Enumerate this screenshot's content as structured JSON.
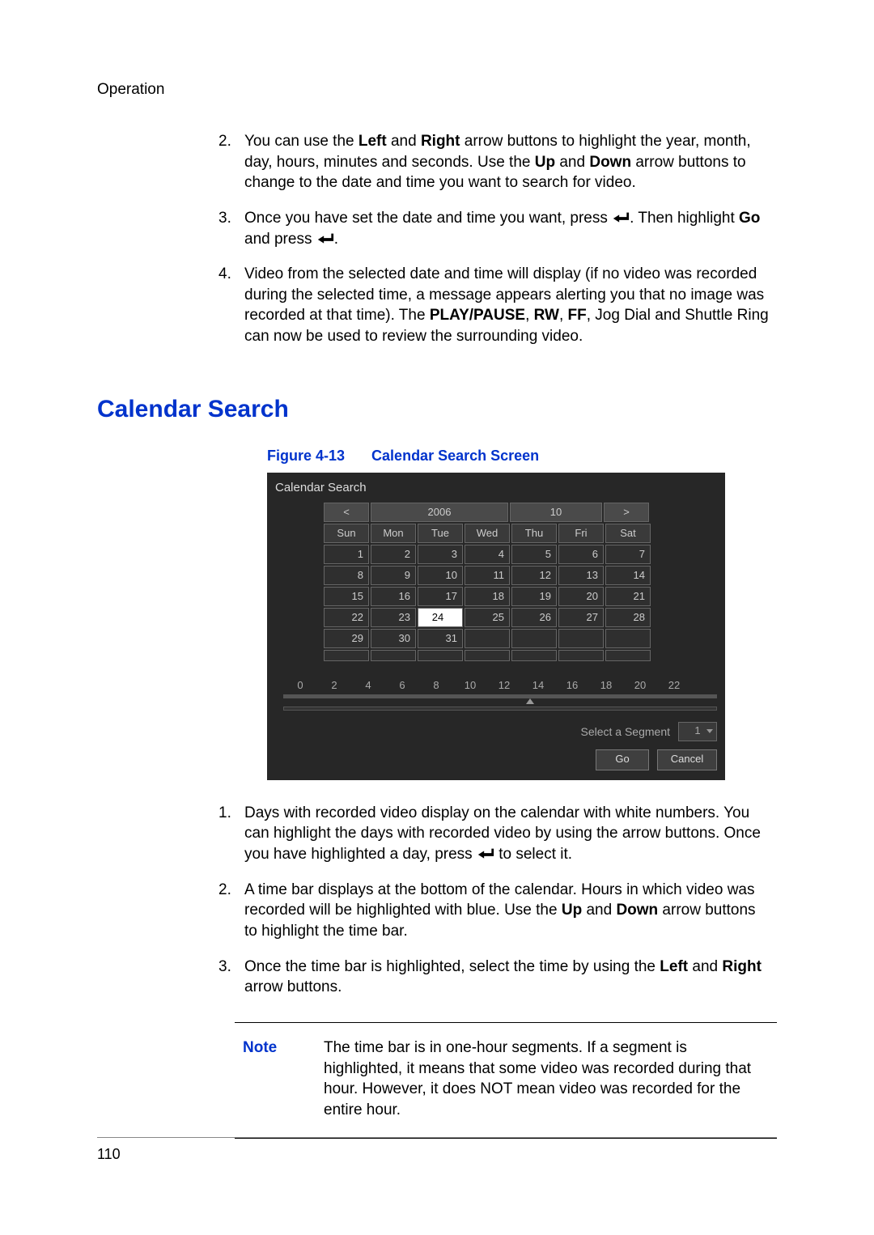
{
  "header": {
    "section": "Operation"
  },
  "steps_top": [
    {
      "num": "2.",
      "html": "You can use the <b>Left</b> and <b>Right</b> arrow buttons to highlight the year, month, day, hours, minutes and seconds. Use the <b>Up</b> and <b>Down</b> arrow buttons to change to the date and time you want to search for video."
    },
    {
      "num": "3.",
      "html": "Once you have set the date and time you want, press {ENTER}. Then highlight <b>Go</b> and press {ENTER}."
    },
    {
      "num": "4.",
      "html": "Video from the selected date and time will display (if no video was recorded during the selected time, a message appears alerting you that no image was recorded at that time). The <b>PLAY/PAUSE</b>, <b>RW</b>, <b>FF</b>, Jog Dial and Shuttle Ring can now be used to review the surrounding video."
    }
  ],
  "heading": "Calendar Search",
  "figure": {
    "label": "Figure 4-13",
    "title": "Calendar Search Screen"
  },
  "screenshot": {
    "title": "Calendar Search",
    "prev": "<",
    "next": ">",
    "year": "2006",
    "month": "10",
    "dow": [
      "Sun",
      "Mon",
      "Tue",
      "Wed",
      "Thu",
      "Fri",
      "Sat"
    ],
    "weeks": [
      [
        "1",
        "2",
        "3",
        "4",
        "5",
        "6",
        "7"
      ],
      [
        "8",
        "9",
        "10",
        "11",
        "12",
        "13",
        "14"
      ],
      [
        "15",
        "16",
        "17",
        "18",
        "19",
        "20",
        "21"
      ],
      [
        "22",
        "23",
        "24",
        "25",
        "26",
        "27",
        "28"
      ],
      [
        "29",
        "30",
        "31",
        "",
        "",
        "",
        ""
      ]
    ],
    "selected_day": "24",
    "ticks": [
      "0",
      "2",
      "4",
      "6",
      "8",
      "10",
      "12",
      "14",
      "16",
      "18",
      "20",
      "22"
    ],
    "segment_label": "Select a Segment",
    "segment_value": "1",
    "go": "Go",
    "cancel": "Cancel"
  },
  "steps_bottom": [
    {
      "num": "1.",
      "html": "Days with recorded video display on the calendar with white numbers. You can highlight the days with recorded video by using the arrow buttons. Once you have highlighted a day, press {ENTER} to select it."
    },
    {
      "num": "2.",
      "html": "A time bar displays at the bottom of the calendar. Hours in which video was recorded will be highlighted with blue. Use the <b>Up</b> and <b>Down</b> arrow buttons to highlight the time bar."
    },
    {
      "num": "3.",
      "html": "Once the time bar is highlighted, select the time by using the <b>Left</b> and <b>Right</b> arrow buttons."
    }
  ],
  "note": {
    "label": "Note",
    "text": "The time bar is in one-hour segments. If a segment is highlighted, it means that some video was recorded during that hour. However, it does NOT mean video was recorded for the entire hour."
  },
  "page_number": "110"
}
